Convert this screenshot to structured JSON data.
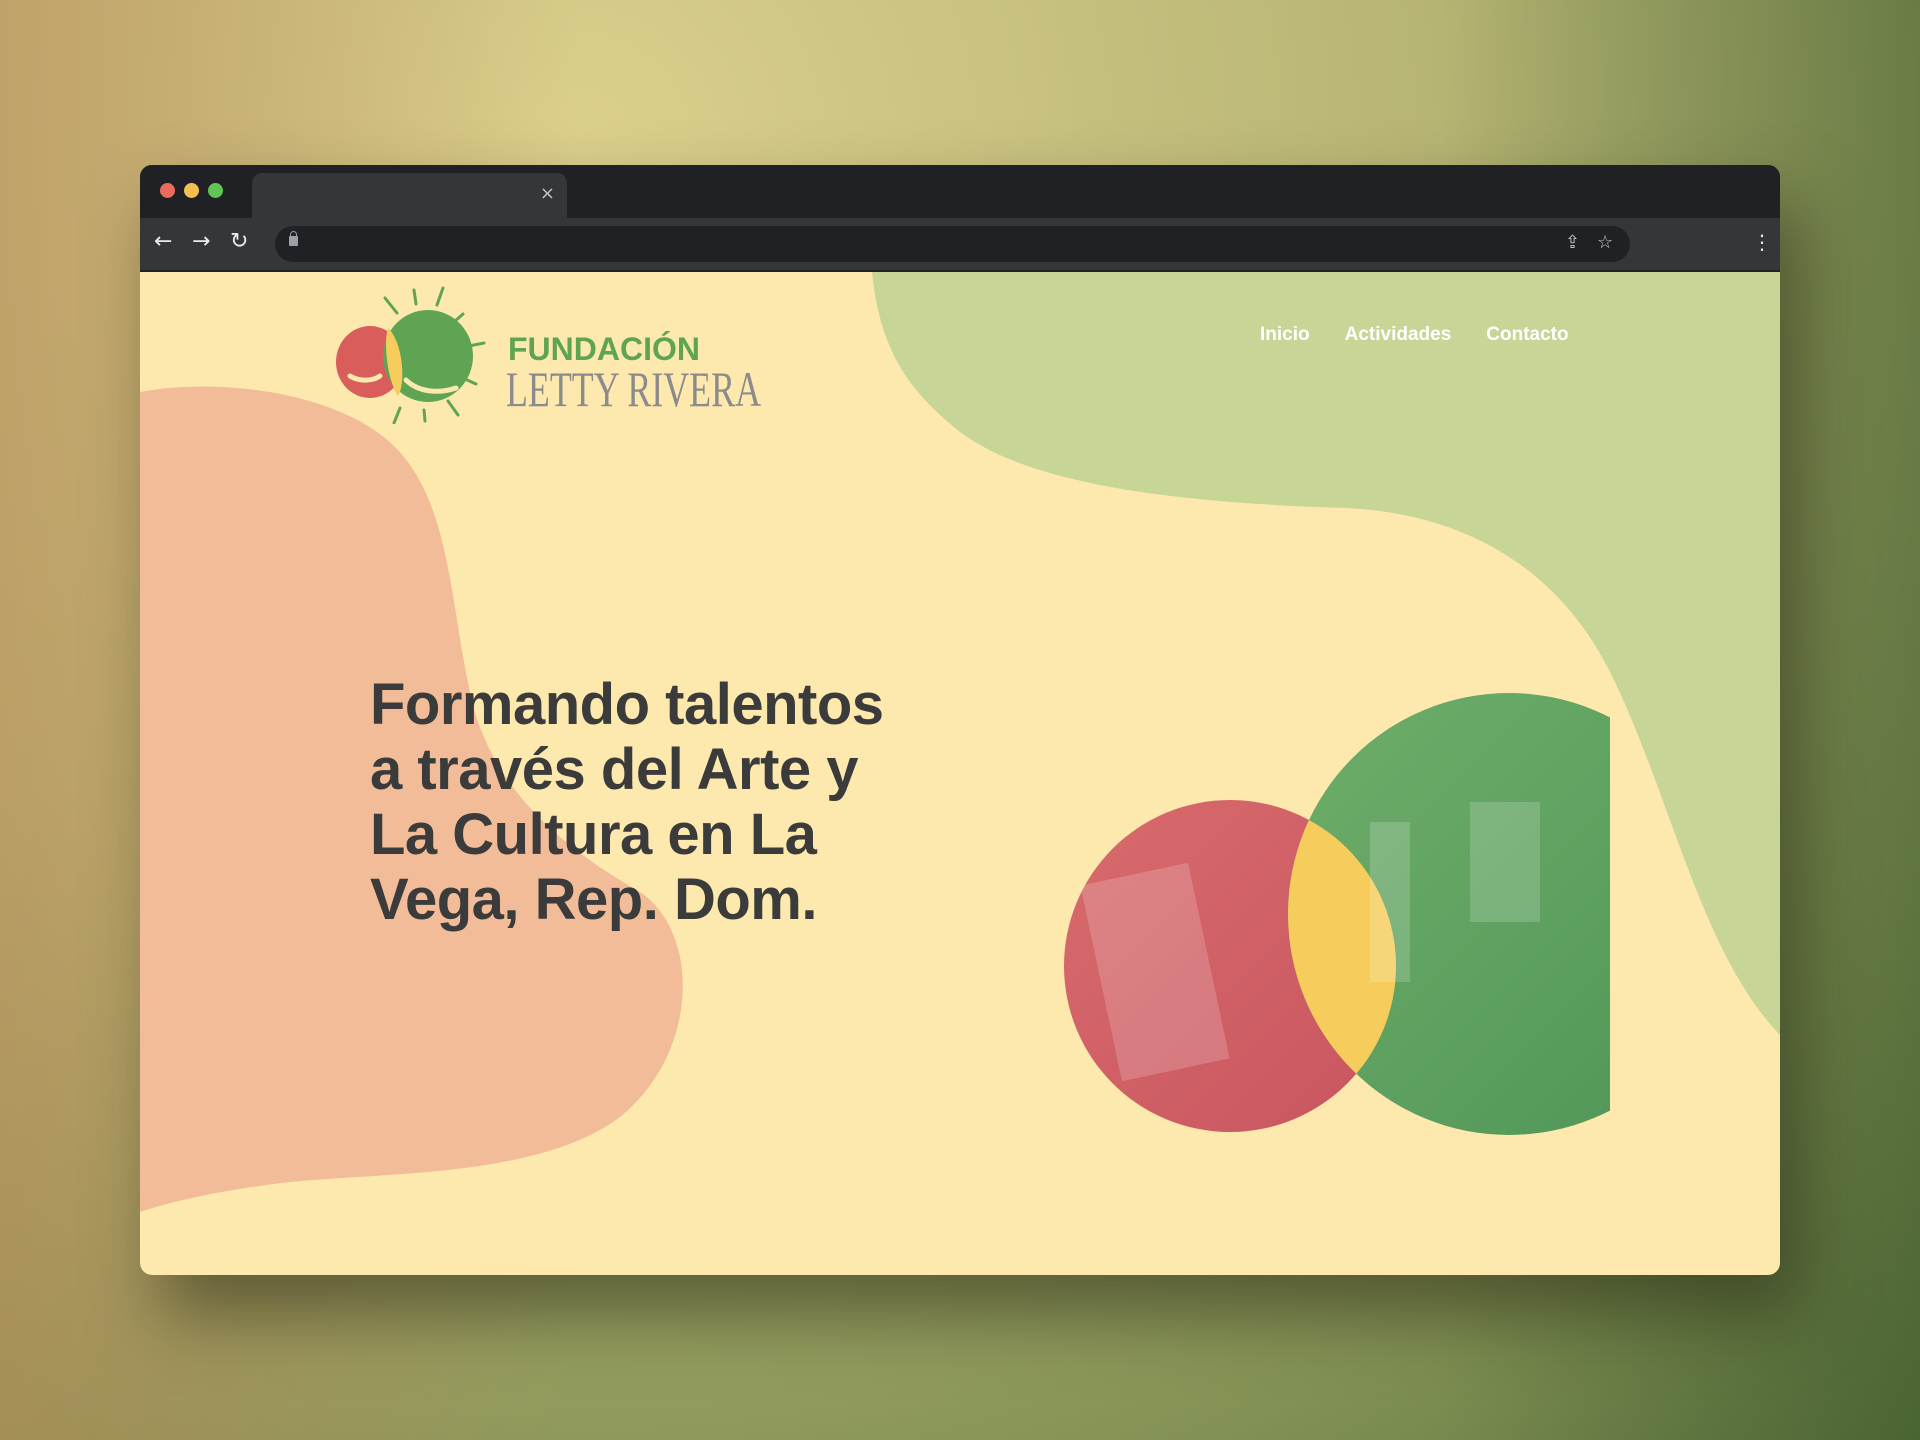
{
  "browser": {
    "tab_close": "×",
    "traffic_lights": [
      "#ed6a5e",
      "#f5bf4f",
      "#61c554"
    ],
    "icons": [
      "back-arrow-icon",
      "forward-arrow-icon",
      "reload-icon",
      "lock-icon",
      "share-icon",
      "star-icon",
      "more-vert-icon"
    ]
  },
  "site": {
    "logo": {
      "line1": "FUNDACIÓN",
      "line2": "LETTY RIVERA"
    },
    "nav": [
      {
        "label": "Inicio"
      },
      {
        "label": "Actividades"
      },
      {
        "label": "Contacto"
      }
    ],
    "headline": "Formando talentos a través del Arte y La Cultura en La Vega, Rep. Dom.",
    "colors": {
      "background": "#fde9ae",
      "green_blob": "#c7d597",
      "peach_blob": "#f1bc97",
      "text": "#3b3b3b",
      "green": "#5ea453",
      "red": "#d95d5b",
      "yellow": "#f6cc5d"
    }
  }
}
